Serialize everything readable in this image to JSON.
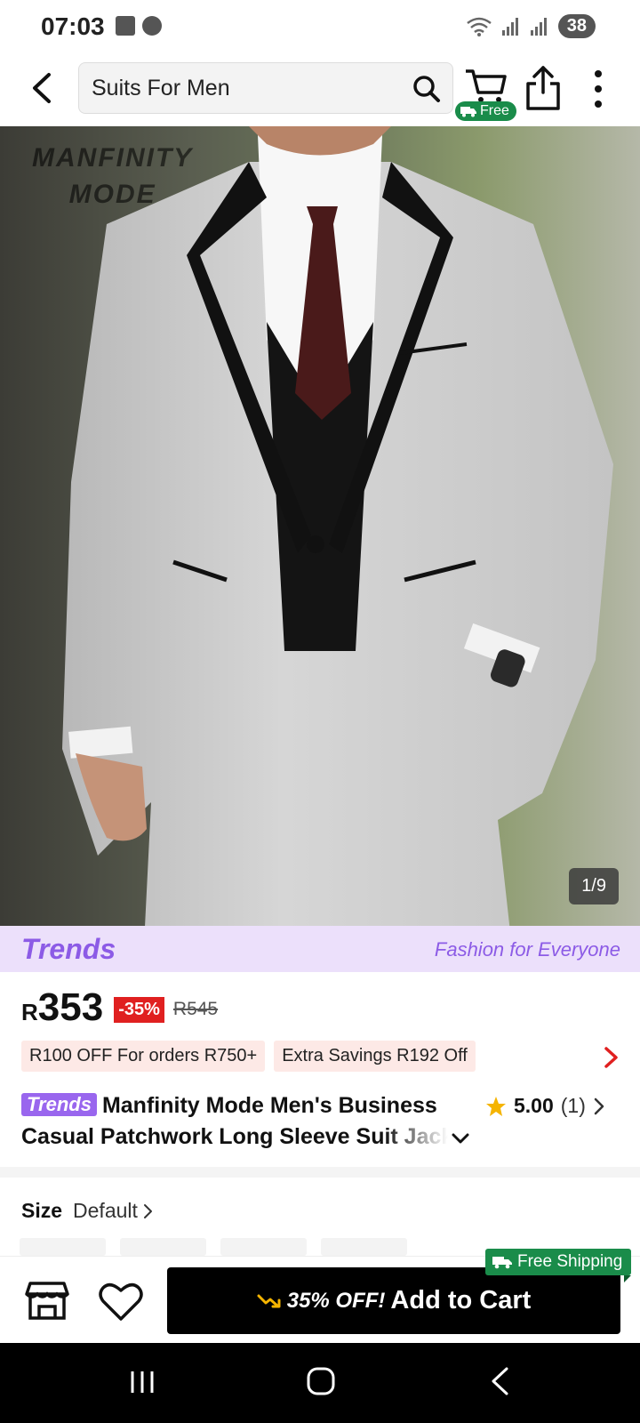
{
  "status_bar": {
    "time": "07:03",
    "battery": "38"
  },
  "search": {
    "query": "Suits For Men"
  },
  "header": {
    "cart_badge": "Free"
  },
  "gallery": {
    "brand_watermark_line1": "MANFINITY",
    "brand_watermark_line2": "MODE",
    "counter": "1/9"
  },
  "trends_banner": {
    "logo": "Trends",
    "slogan": "Fashion for Everyone"
  },
  "price": {
    "currency": "R",
    "amount": "353",
    "discount": "-35%",
    "original": "R545"
  },
  "coupons": [
    "R100 OFF For orders R750+",
    "Extra Savings R192 Off"
  ],
  "product": {
    "tag": "Trends",
    "title_line1": "Manfinity Mode Men's Business",
    "title_line2": "Casual Patchwork Long Sleeve Suit Jacket"
  },
  "rating": {
    "value": "5.00",
    "count": "(1)"
  },
  "size": {
    "label": "Size",
    "value": "Default"
  },
  "actions": {
    "free_shipping": "Free Shipping",
    "add_to_cart_promo": "35% OFF!",
    "add_to_cart_label": "Add to Cart"
  },
  "colors": {
    "accent_green": "#1a8c4a",
    "discount_red": "#e02020",
    "trends_purple": "#8c5be6"
  },
  "icons": [
    "back-icon",
    "search-icon",
    "cart-icon",
    "share-icon",
    "more-icon",
    "store-icon",
    "heart-icon",
    "star-icon",
    "truck-icon"
  ]
}
